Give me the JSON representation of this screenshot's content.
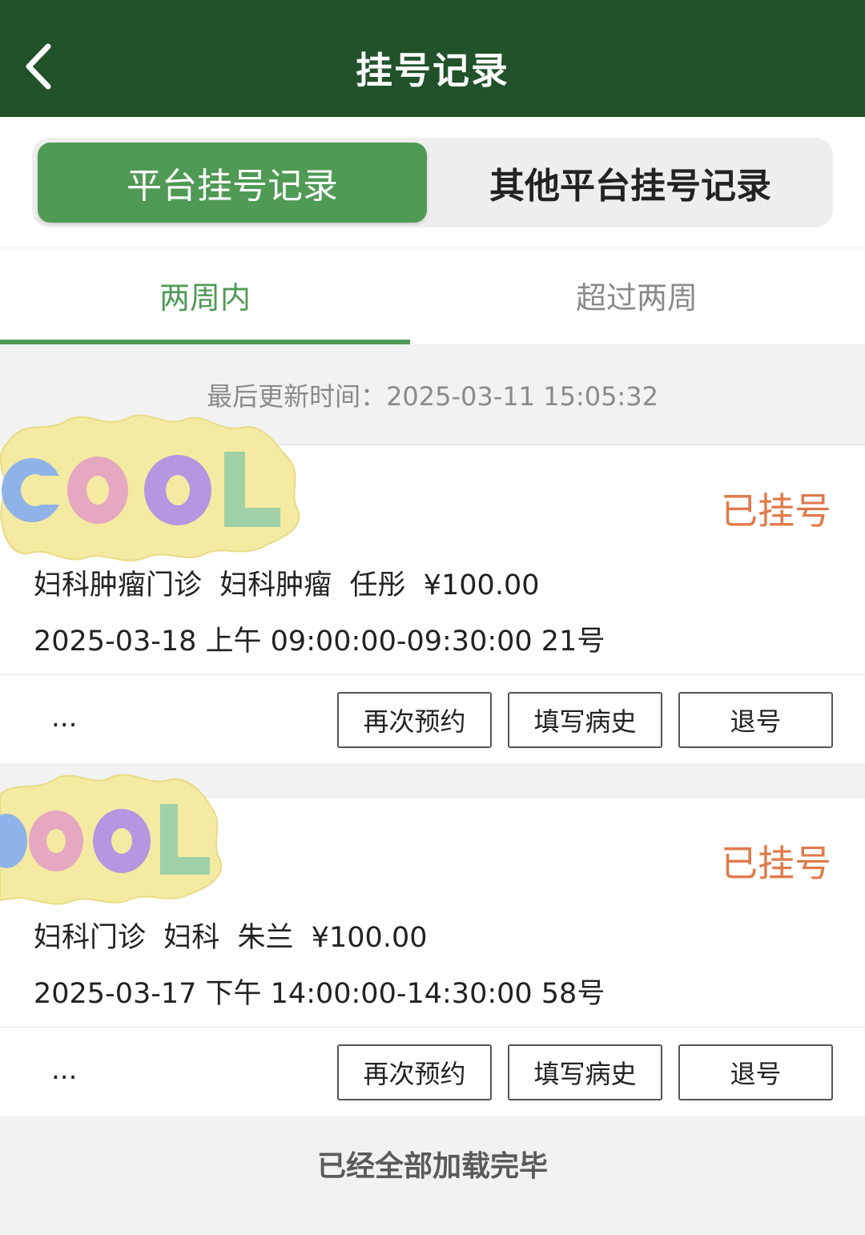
{
  "header": {
    "title": "挂号记录",
    "back_icon": "chevron-left-icon"
  },
  "segment": {
    "items": [
      {
        "label": "平台挂号记录",
        "active": true
      },
      {
        "label": "其他平台挂号记录",
        "active": false
      }
    ]
  },
  "tabs": {
    "items": [
      {
        "label": "两周内",
        "active": true
      },
      {
        "label": "超过两周",
        "active": false
      }
    ]
  },
  "last_updated": "最后更新时间：2025-03-11 15:05:32",
  "colors": {
    "header_bg": "#21522a",
    "accent_green": "#4f9a55",
    "status_orange": "#e07a4b"
  },
  "records": [
    {
      "status": "已挂号",
      "details": "妇科肿瘤门诊  妇科肿瘤  任彤  ¥100.00",
      "schedule": "2025-03-18 上午 09:00:00-09:30:00 21号",
      "more": "...",
      "actions": [
        "再次预约",
        "填写病史",
        "退号"
      ],
      "sticker_icon": "cool-sticker-icon"
    },
    {
      "status": "已挂号",
      "details": "妇科门诊  妇科  朱兰  ¥100.00",
      "schedule": "2025-03-17 下午 14:00:00-14:30:00 58号",
      "more": "...",
      "actions": [
        "再次预约",
        "填写病史",
        "退号"
      ],
      "sticker_icon": "cool-sticker-icon"
    }
  ],
  "footer": "已经全部加载完毕"
}
